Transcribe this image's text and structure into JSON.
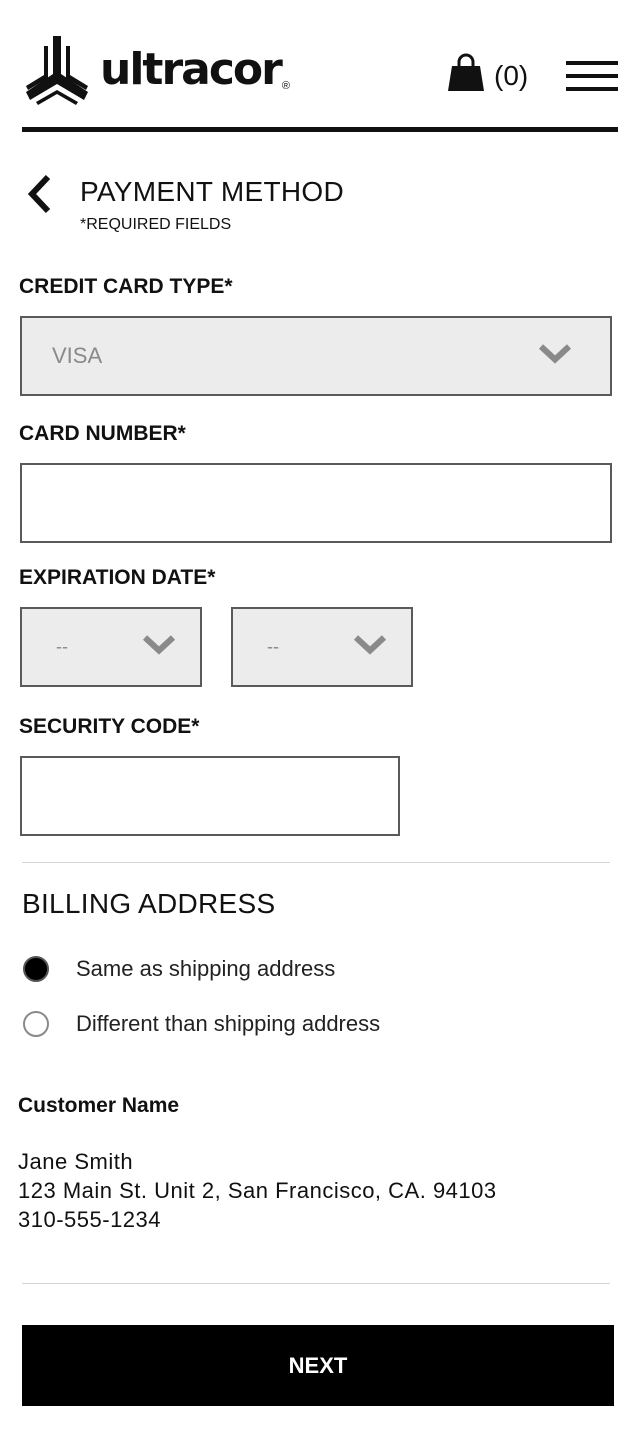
{
  "header": {
    "logo_text": "ultracor",
    "logo_registered": "®",
    "cart_count": "(0)",
    "icons": [
      "ultracor-logo-icon",
      "shopping-bag-icon",
      "hamburger-menu-icon"
    ]
  },
  "title": {
    "heading": "PAYMENT METHOD",
    "required_note": "*REQUIRED FIELDS",
    "back_icon": "chevron-left-icon"
  },
  "form": {
    "card_type": {
      "label": "CREDIT CARD TYPE*",
      "value": "VISA"
    },
    "card_number": {
      "label": "CARD NUMBER*",
      "value": ""
    },
    "expiration": {
      "label": "EXPIRATION DATE*",
      "month_value": "--",
      "year_value": "--"
    },
    "security_code": {
      "label": "SECURITY CODE*",
      "value": ""
    }
  },
  "billing": {
    "title": "BILLING ADDRESS",
    "options": [
      {
        "label": "Same as shipping address",
        "checked": true
      },
      {
        "label": "Different than shipping address",
        "checked": false
      }
    ]
  },
  "customer": {
    "label": "Customer Name",
    "name": "Jane Smith",
    "address": "123 Main St. Unit 2, San Francisco, CA. 94103",
    "phone": "310-555-1234"
  },
  "actions": {
    "next_label": "NEXT"
  },
  "colors": {
    "text": "#111111",
    "select_bg": "#ececec",
    "border": "#5a5a5a",
    "chevron": "#8a8a8a",
    "button_bg": "#000000",
    "button_text": "#ffffff"
  }
}
